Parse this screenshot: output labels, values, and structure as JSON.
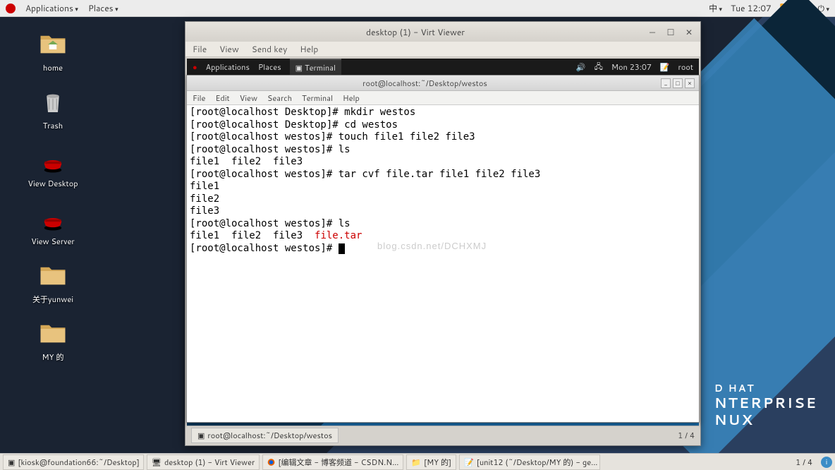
{
  "topbar": {
    "applications": "Applications",
    "places": "Places",
    "ime": "中",
    "clock": "Tue 12:07"
  },
  "desktop_icons": [
    {
      "label": "home",
      "type": "folder"
    },
    {
      "label": "Trash",
      "type": "trash"
    },
    {
      "label": "View Desktop",
      "type": "redhat"
    },
    {
      "label": "View Server",
      "type": "redhat"
    },
    {
      "label": "关于yunwei",
      "type": "folder"
    },
    {
      "label": "MY 的",
      "type": "folder"
    }
  ],
  "brand": {
    "l1": "D HAT",
    "l2": "NTERPRISE",
    "l3": "NUX"
  },
  "virtviewer": {
    "title": "desktop (1) - Virt Viewer",
    "menu": [
      "File",
      "View",
      "Send key",
      "Help"
    ]
  },
  "guest": {
    "applications": "Applications",
    "places": "Places",
    "terminal_tab": "Terminal",
    "clock": "Mon 23:07",
    "user": "root",
    "taskbar_item": "root@localhost:~/Desktop/westos",
    "pager": "1 / 4"
  },
  "terminal": {
    "title": "root@localhost:~/Desktop/westos",
    "menu": [
      "File",
      "Edit",
      "View",
      "Search",
      "Terminal",
      "Help"
    ],
    "lines": [
      "[root@localhost Desktop]# mkdir westos",
      "[root@localhost Desktop]# cd westos",
      "[root@localhost westos]# touch file1 file2 file3",
      "[root@localhost westos]# ls",
      "file1  file2  file3",
      "[root@localhost westos]# tar cvf file.tar file1 file2 file3",
      "file1",
      "file2",
      "file3",
      "[root@localhost westos]# ls"
    ],
    "ls_line_plain": "file1  file2  file3  ",
    "ls_line_red": "file.tar",
    "prompt_final": "[root@localhost westos]# ",
    "watermark": "blog.csdn.net/DCHXMJ"
  },
  "bottombar": {
    "items": [
      "[kiosk@foundation66:~/Desktop]",
      "desktop (1) - Virt Viewer",
      "[编辑文章 - 博客频道 - CSDN.N...",
      "[MY 的]",
      "[unit12 (~/Desktop/MY 的) - ge..."
    ],
    "pager": "1 / 4"
  }
}
